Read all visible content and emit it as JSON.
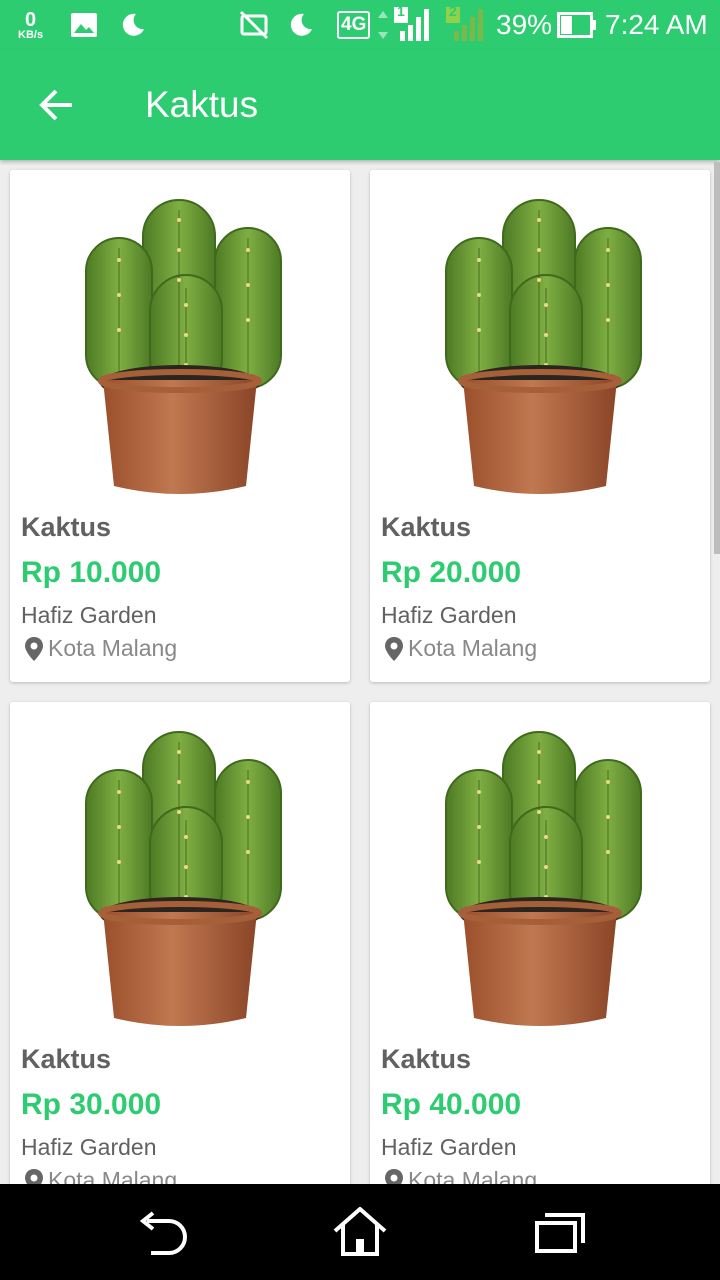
{
  "status_bar": {
    "net_speed_value": "0",
    "net_speed_unit": "KB/s",
    "network_type": "4G",
    "sim1_label": "1",
    "sim2_label": "2",
    "battery_percent": "39%",
    "battery_level": 0.39,
    "time": "7:24 AM"
  },
  "app_bar": {
    "title": "Kaktus"
  },
  "colors": {
    "primary": "#2ecc71",
    "price": "#2ecc71",
    "text_dark": "#616161",
    "text_muted": "#888888"
  },
  "products": [
    {
      "name": "Kaktus",
      "price": "Rp 10.000",
      "shop": "Hafiz Garden",
      "location": "Kota Malang"
    },
    {
      "name": "Kaktus",
      "price": "Rp 20.000",
      "shop": "Hafiz Garden",
      "location": "Kota Malang"
    },
    {
      "name": "Kaktus",
      "price": "Rp 30.000",
      "shop": "Hafiz Garden",
      "location": "Kota Malang"
    },
    {
      "name": "Kaktus",
      "price": "Rp 40.000",
      "shop": "Hafiz Garden",
      "location": "Kota Malang"
    }
  ],
  "icons": {
    "back": "arrow-back-icon",
    "location": "location-pin-icon",
    "nav_back": "nav-back-icon",
    "nav_home": "nav-home-icon",
    "nav_recents": "nav-recents-icon"
  }
}
